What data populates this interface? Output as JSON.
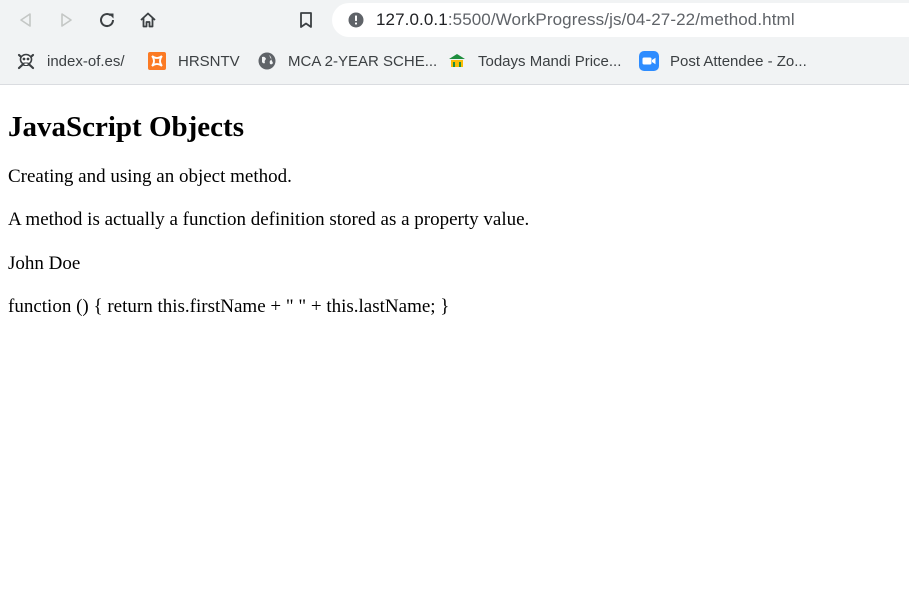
{
  "browser": {
    "back_icon": "back-arrow-icon",
    "forward_icon": "forward-arrow-icon",
    "reload_icon": "reload-icon",
    "home_icon": "home-icon",
    "bookmark_icon": "bookmark-icon",
    "info_icon": "info-icon",
    "url_host": "127.0.0.1",
    "url_path": ":5500/WorkProgress/js/04-27-22/method.html"
  },
  "bookmarks": [
    {
      "label": "index-of.es/",
      "icon": "skull-icon"
    },
    {
      "label": "HRSNTV",
      "icon": "xampp-icon"
    },
    {
      "label": "MCA 2-YEAR SCHE...",
      "icon": "globe-icon"
    },
    {
      "label": "Todays Mandi Price...",
      "icon": "mandi-icon"
    },
    {
      "label": "Post Attendee - Zo...",
      "icon": "zoom-video-icon"
    }
  ],
  "page": {
    "heading": "JavaScript Objects",
    "paragraph_1": "Creating and using an object method.",
    "paragraph_2": "A method is actually a function definition stored as a property value.",
    "paragraph_3": "John Doe",
    "paragraph_4": "function () { return this.firstName + \" \" + this.lastName; }"
  },
  "colors": {
    "chrome_bg": "#f1f3f4",
    "icon_gray": "#5f6368",
    "xampp_orange": "#fb7a24",
    "zoom_blue": "#2d8cff"
  }
}
